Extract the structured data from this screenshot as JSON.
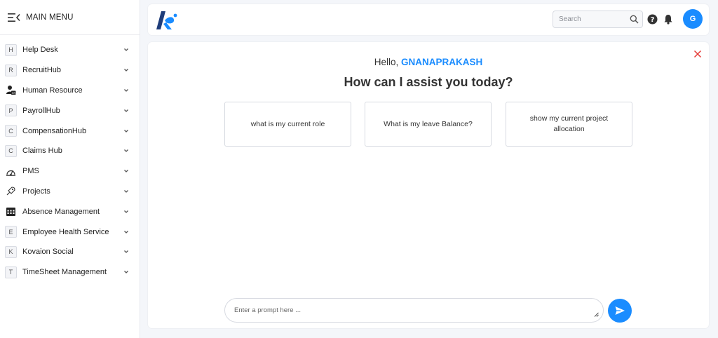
{
  "sidebar": {
    "title": "MAIN MENU",
    "items": [
      {
        "icon": "H",
        "label": "Help Desk"
      },
      {
        "icon": "R",
        "label": "RecruitHub"
      },
      {
        "icon": "human-resource-icon",
        "label": "Human Resource"
      },
      {
        "icon": "P",
        "label": "PayrollHub"
      },
      {
        "icon": "C",
        "label": "CompensationHub"
      },
      {
        "icon": "C",
        "label": "Claims Hub"
      },
      {
        "icon": "pms-icon",
        "label": "PMS"
      },
      {
        "icon": "projects-icon",
        "label": "Projects"
      },
      {
        "icon": "calendar-icon",
        "label": "Absence Management"
      },
      {
        "icon": "E",
        "label": "Employee Health Service"
      },
      {
        "icon": "K",
        "label": "Kovaion Social"
      },
      {
        "icon": "T",
        "label": "TimeSheet Management"
      }
    ]
  },
  "topbar": {
    "search_placeholder": "Search",
    "avatar_initial": "G"
  },
  "main": {
    "greeting_prefix": "Hello,",
    "user_name": "GNANAPRAKASH",
    "headline": "How can I assist you today?",
    "suggestions": [
      "what is my current role",
      "What is my leave Balance?",
      "show my current project allocation"
    ],
    "prompt_placeholder": "Enter a prompt here ..."
  },
  "colors": {
    "accent": "#1a8cff",
    "close": "#e53935",
    "logo_dark": "#1f3d7a"
  }
}
